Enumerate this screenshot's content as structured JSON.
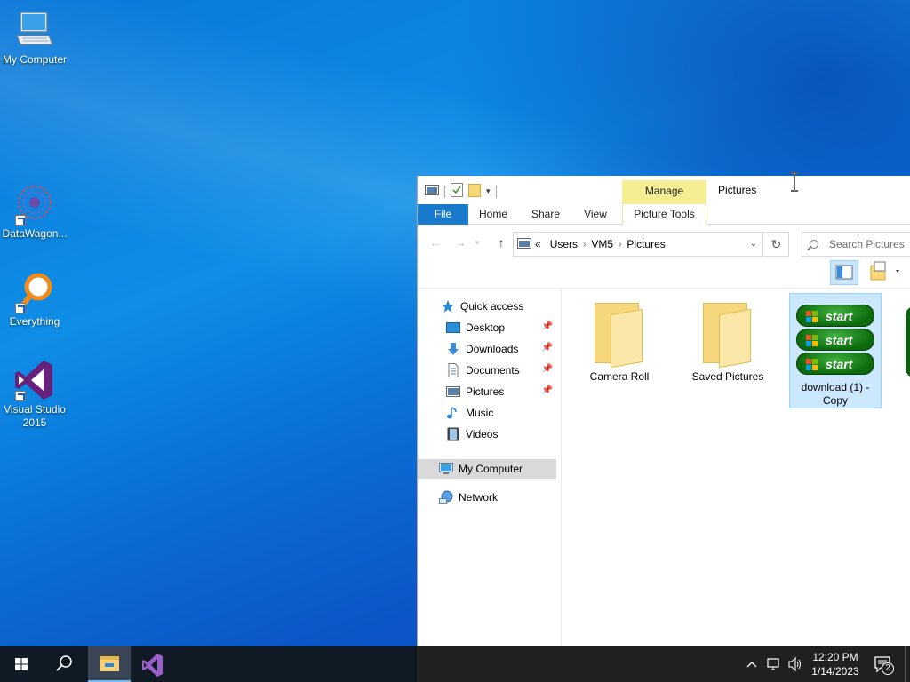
{
  "desktop": {
    "icons": [
      {
        "label": "My Computer",
        "icon": "computer-icon"
      },
      {
        "label": "DataWagon...",
        "icon": "datawagon-icon"
      },
      {
        "label": "Everything",
        "icon": "everything-search-icon"
      },
      {
        "label": "Visual Studio 2015",
        "icon": "visual-studio-icon"
      }
    ]
  },
  "explorer": {
    "title": "Pictures",
    "manage_tab": "Manage",
    "tabs": [
      "File",
      "Home",
      "Share",
      "View",
      "Picture Tools"
    ],
    "address": {
      "overflow": "«",
      "crumbs": [
        "Users",
        "VM5",
        "Pictures"
      ]
    },
    "search": {
      "placeholder": "Search Pictures"
    },
    "nav": {
      "quick_access": "Quick access",
      "items": [
        "Desktop",
        "Downloads",
        "Documents",
        "Pictures",
        "Music",
        "Videos"
      ],
      "my_computer": "My Computer",
      "network": "Network"
    },
    "files": [
      {
        "name": "Camera Roll",
        "type": "folder"
      },
      {
        "name": "Saved Pictures",
        "type": "folder"
      },
      {
        "name": "download (1) - Copy",
        "type": "image",
        "selected": true
      }
    ],
    "thumbnail_text": "start"
  },
  "taskbar": {
    "time": "12:20 PM",
    "date": "1/14/2023",
    "notification_count": "2"
  },
  "colors": {
    "accent": "#1979ca",
    "selection": "#cce8ff",
    "manage": "#f5ee94",
    "taskbar": "#101a25"
  }
}
